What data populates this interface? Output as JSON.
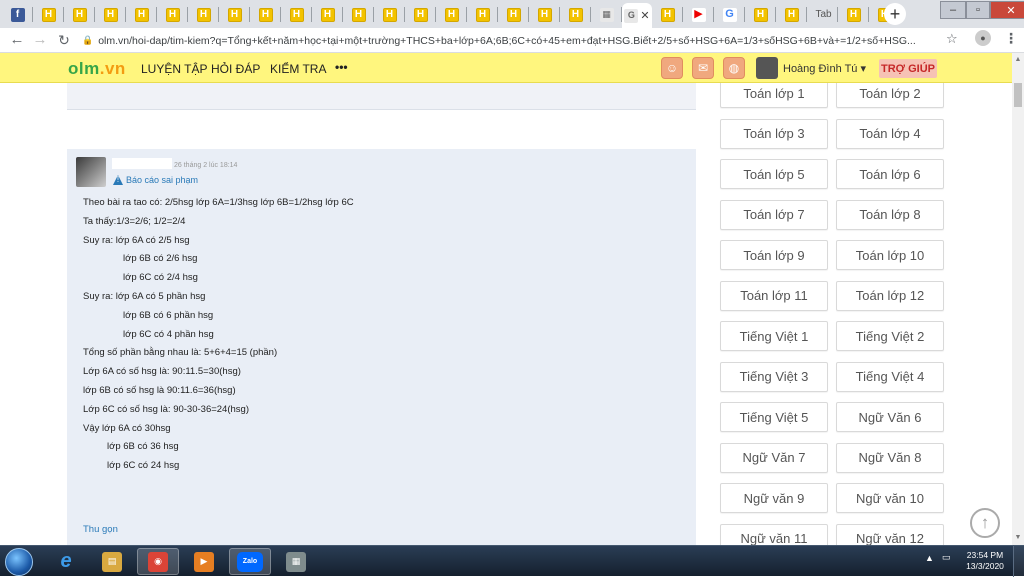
{
  "browser": {
    "tabs": [
      {
        "icon": "facebook",
        "glyph": "f"
      },
      {
        "icon": "olm",
        "glyph": "H"
      },
      {
        "icon": "olm",
        "glyph": "H"
      },
      {
        "icon": "olm",
        "glyph": "H"
      },
      {
        "icon": "olm",
        "glyph": "H"
      },
      {
        "icon": "olm",
        "glyph": "H"
      },
      {
        "icon": "olm",
        "glyph": "H"
      },
      {
        "icon": "olm",
        "glyph": "H"
      },
      {
        "icon": "olm",
        "glyph": "H"
      },
      {
        "icon": "olm",
        "glyph": "H"
      },
      {
        "icon": "olm",
        "glyph": "H"
      },
      {
        "icon": "olm",
        "glyph": "H"
      },
      {
        "icon": "olm",
        "glyph": "H"
      },
      {
        "icon": "olm",
        "glyph": "H"
      },
      {
        "icon": "olm",
        "glyph": "H"
      },
      {
        "icon": "olm",
        "glyph": "H"
      },
      {
        "icon": "olm",
        "glyph": "H"
      },
      {
        "icon": "olm",
        "glyph": "H"
      },
      {
        "icon": "olm",
        "glyph": "H"
      },
      {
        "icon": "colorful",
        "glyph": "▦"
      },
      {
        "icon": "active",
        "glyph": "G",
        "close": "✕"
      },
      {
        "icon": "olm",
        "glyph": "H"
      },
      {
        "icon": "youtube",
        "glyph": "▶"
      },
      {
        "icon": "google",
        "glyph": "G"
      },
      {
        "icon": "olm",
        "glyph": "H"
      },
      {
        "icon": "olm",
        "glyph": "H"
      },
      {
        "icon": "text",
        "label": "Tab"
      },
      {
        "icon": "olm",
        "glyph": "H"
      },
      {
        "icon": "olm",
        "glyph": "H"
      }
    ],
    "new_tab": "+",
    "url": "olm.vn/hoi-dap/tim-kiem?q=Tổng+kết+năm+học+tại+một+trường+THCS+ba+lớp+6A;6B;6C+có+45+em+đạt+HSG.Biết+2/5+số+HSG+6A=1/3+sốHSG+6B+và+=1/2+số+HSG...",
    "window_controls": {
      "min": "–",
      "max": "▫",
      "close": "✕"
    }
  },
  "site": {
    "logo_green": "olm",
    "logo_orange": ".vn",
    "menu": [
      "LUYỆN TẬP",
      "HỎI ĐÁP",
      "KIỂM TRA",
      "•••"
    ],
    "user_name": "Hoàng Đình Tú ▾",
    "help": "TRỢ GIÚP"
  },
  "answer": {
    "timestamp": "26 tháng 2 lúc 18:14",
    "report": "Báo cáo sai phạm",
    "lines": [
      "Theo bài ra tao có: 2/5hsg lớp 6A=1/3hsg lớp 6B=1/2hsg lớp 6C",
      "Ta thấy:1/3=2/6; 1/2=2/4",
      "Suy ra: lớp 6A có 2/5 hsg",
      "lớp 6B có 2/6 hsg",
      "lớp 6C có 2/4 hsg",
      "Suy ra: lớp 6A có 5 phần hsg",
      "lớp 6B có 6 phần hsg",
      "lớp 6C có 4 phần hsg",
      "Tổng số phần bằng nhau là: 5+6+4=15 (phần)",
      "Lớp 6A có số hsg là: 90:11.5=30(hsg)",
      "lớp 6B có số hsg là 90:11.6=36(hsg)",
      "Lớp 6C có số hsg là: 90-30-36=24(hsg)",
      "Vậy lớp 6A có 30hsg",
      "lớp 6B có 36 hsg",
      "lớp 6C có 24 hsg"
    ],
    "collapse": "Thu gọn"
  },
  "sidebar": {
    "subjects": [
      "Toán lớp 1",
      "Toán lớp 2",
      "Toán lớp 3",
      "Toán lớp 4",
      "Toán lớp 5",
      "Toán lớp 6",
      "Toán lớp 7",
      "Toán lớp 8",
      "Toán lớp 9",
      "Toán lớp 10",
      "Toán lớp 11",
      "Toán lớp 12",
      "Tiếng Việt 1",
      "Tiếng Việt 2",
      "Tiếng Việt 3",
      "Tiếng Việt 4",
      "Tiếng Việt 5",
      "Ngữ Văn 6",
      "Ngữ Văn 7",
      "Ngữ Văn 8",
      "Ngữ văn 9",
      "Ngữ văn 10",
      "Ngữ văn 11",
      "Ngữ văn 12"
    ]
  },
  "taskbar": {
    "apps": [
      {
        "name": "internet-explorer",
        "glyph": "e"
      },
      {
        "name": "file-explorer",
        "glyph": "▤"
      },
      {
        "name": "chrome",
        "glyph": "◉"
      },
      {
        "name": "media-player",
        "glyph": "▶"
      },
      {
        "name": "zalo",
        "glyph": "Zalo"
      },
      {
        "name": "calculator",
        "glyph": "▦"
      }
    ],
    "time": "23:54 PM",
    "date": "13/3/2020"
  }
}
